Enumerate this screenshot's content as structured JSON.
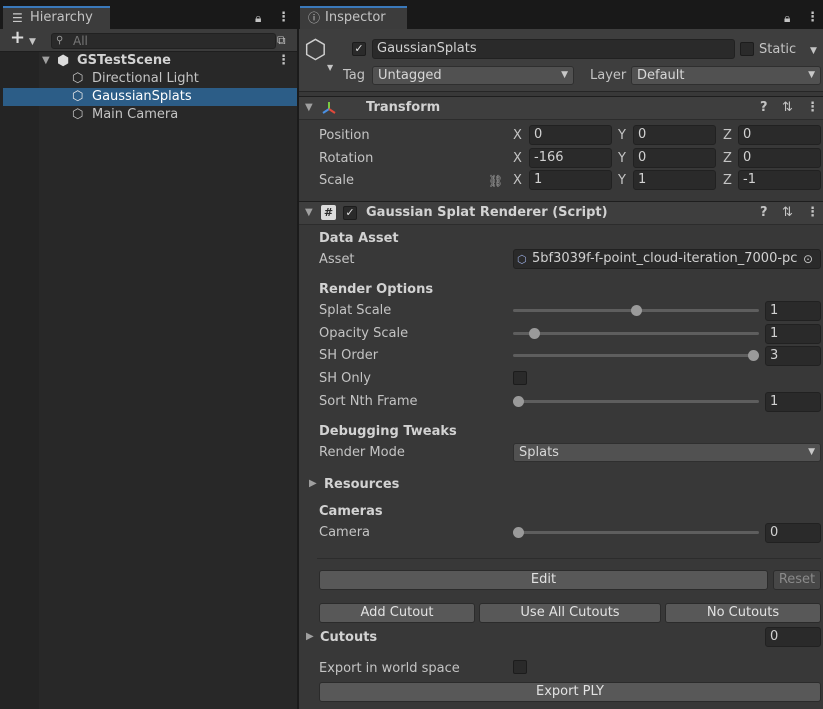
{
  "hierarchy": {
    "tab_label": "Hierarchy",
    "search_placeholder": "All",
    "add_label": "+",
    "scene_name": "GSTestScene",
    "items": [
      {
        "label": "Directional Light"
      },
      {
        "label": "GaussianSplats"
      },
      {
        "label": "Main Camera"
      }
    ]
  },
  "inspector": {
    "tab_label": "Inspector",
    "object_name": "GaussianSplats",
    "static_label": "Static",
    "tag_label": "Tag",
    "tag_value": "Untagged",
    "layer_label": "Layer",
    "layer_value": "Default",
    "transform": {
      "title": "Transform",
      "rows": [
        {
          "label": "Position",
          "x": "0",
          "y": "0",
          "z": "0"
        },
        {
          "label": "Rotation",
          "x": "-166",
          "y": "0",
          "z": "0"
        },
        {
          "label": "Scale",
          "x": "1",
          "y": "1",
          "z": "-1"
        }
      ],
      "axis_x": "X",
      "axis_y": "Y",
      "axis_z": "Z"
    },
    "renderer": {
      "title": "Gaussian Splat Renderer (Script)",
      "data_asset_heading": "Data Asset",
      "asset_label": "Asset",
      "asset_value": "5bf3039f-f-point_cloud-iteration_7000-pc",
      "render_options_heading": "Render Options",
      "splat_scale_label": "Splat Scale",
      "splat_scale_value": "1",
      "opacity_scale_label": "Opacity Scale",
      "opacity_scale_value": "1",
      "sh_order_label": "SH Order",
      "sh_order_value": "3",
      "sh_only_label": "SH Only",
      "sort_nth_label": "Sort Nth Frame",
      "sort_nth_value": "1",
      "debug_heading": "Debugging Tweaks",
      "render_mode_label": "Render Mode",
      "render_mode_value": "Splats",
      "resources_label": "Resources",
      "cameras_heading": "Cameras",
      "camera_label": "Camera",
      "camera_value": "0",
      "edit_label": "Edit",
      "reset_label": "Reset",
      "add_cutout_label": "Add Cutout",
      "use_all_cutouts_label": "Use All Cutouts",
      "no_cutouts_label": "No Cutouts",
      "cutouts_label": "Cutouts",
      "cutouts_value": "0",
      "export_world_label": "Export in world space",
      "export_ply_label": "Export PLY"
    }
  },
  "slider_levels": {
    "splat_scale": 0.5,
    "opacity_scale": 0.07,
    "sh_order": 1.0,
    "sort_nth": 0.0,
    "camera": 0.0
  },
  "colors": {
    "selection": "#2c5d87",
    "tab_accent": "#3a79bb"
  }
}
